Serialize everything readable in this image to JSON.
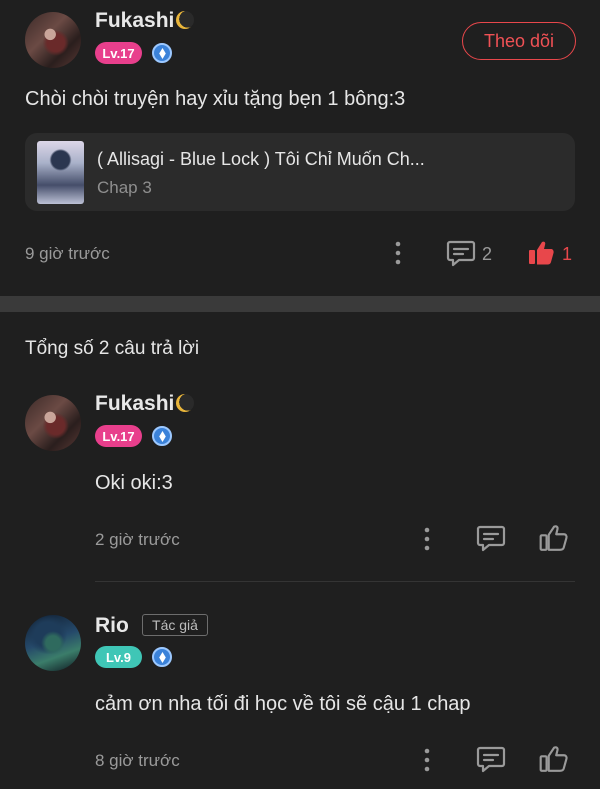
{
  "post": {
    "author": "Fukashi",
    "level": "Lv.17",
    "follow_label": "Theo dõi",
    "content": "Chòi chòi truyện hay xỉu tặng bẹn 1 bông:3",
    "story": {
      "title": "( Allisagi - Blue Lock ) Tôi Chỉ Muốn Ch...",
      "chapter": "Chap 3"
    },
    "time": "9 giờ trước",
    "reply_count": "2",
    "like_count": "1"
  },
  "replies_header": "Tổng số 2 câu trả lời",
  "replies": [
    {
      "author": "Fukashi",
      "level": "Lv.17",
      "content": "Oki oki:3",
      "time": "2 giờ trước"
    },
    {
      "author": "Rio",
      "tag": "Tác giả",
      "level": "Lv.9",
      "content": "cảm ơn nha tối đi học về tôi sẽ cậu 1 chap",
      "time": "8 giờ trước"
    }
  ],
  "colors": {
    "accent": "#e8474b",
    "level_pink": "#e83f8c",
    "level_teal": "#3fc6b6"
  }
}
